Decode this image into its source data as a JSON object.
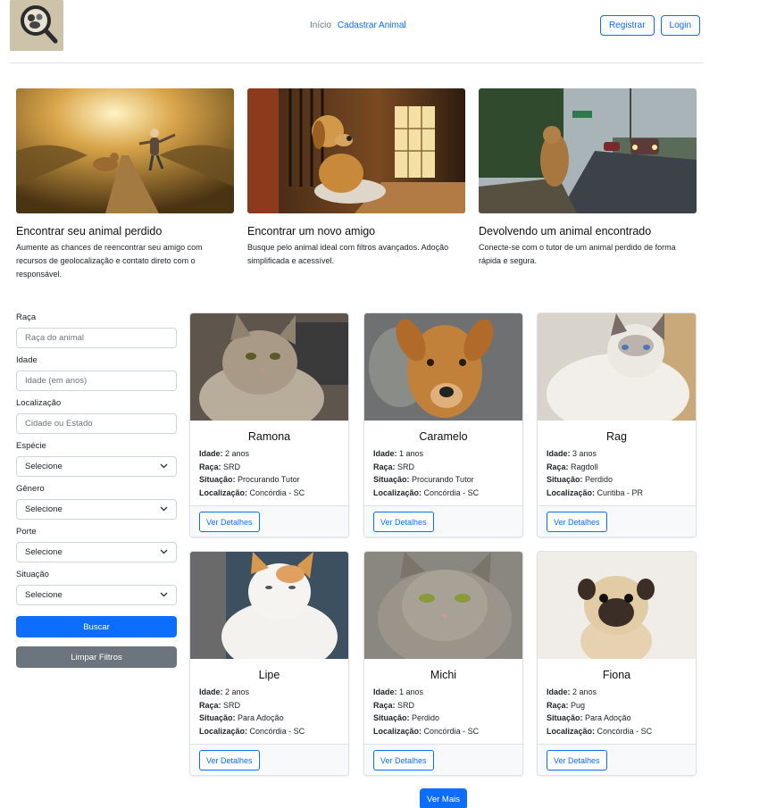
{
  "nav": {
    "home": "Início",
    "register_animal": "Cadastrar Animal"
  },
  "auth": {
    "register": "Registrar",
    "login": "Login"
  },
  "features": [
    {
      "title": "Encontrar seu animal perdido",
      "text": "Aumente as chances de reencontrar seu amigo com recursos de geolocalização e contato direto com o responsável."
    },
    {
      "title": "Encontrar um novo amigo",
      "text": "Busque pelo animal ideal com filtros avançados. Adoção simplificada e acessível."
    },
    {
      "title": "Devolvendo um animal encontrado",
      "text": "Conecte-se com o tutor de um animal perdido de forma rápida e segura."
    }
  ],
  "filters": {
    "breed": {
      "label": "Raça",
      "placeholder": "Raça do animal"
    },
    "age": {
      "label": "Idade",
      "placeholder": "Idade (em anos)"
    },
    "location": {
      "label": "Localização",
      "placeholder": "Cidade ou Estado"
    },
    "species": {
      "label": "Espécie",
      "value": "Selecione"
    },
    "gender": {
      "label": "Gênero",
      "value": "Selecione"
    },
    "size": {
      "label": "Porte",
      "value": "Selecione"
    },
    "status": {
      "label": "Situação",
      "value": "Selecione"
    },
    "search_button": "Buscar",
    "clear_button": "Limpar Filtros"
  },
  "labels": {
    "age": "Idade:",
    "breed": "Raça:",
    "status": "Situação:",
    "location": "Localização:",
    "details": "Ver Detalhes"
  },
  "animals": [
    {
      "name": "Ramona",
      "age": "2 anos",
      "breed": "SRD",
      "status": "Procurando Tutor",
      "location": "Concórdia - SC"
    },
    {
      "name": "Caramelo",
      "age": "1 anos",
      "breed": "SRD",
      "status": "Procurando Tutor",
      "location": "Concórdia - SC"
    },
    {
      "name": "Rag",
      "age": "3 anos",
      "breed": "Ragdoll",
      "status": "Perdido",
      "location": "Curitiba - PR"
    },
    {
      "name": "Lipe",
      "age": "2 anos",
      "breed": "SRD",
      "status": "Para Adoção",
      "location": "Concórdia - SC"
    },
    {
      "name": "Michi",
      "age": "1 anos",
      "breed": "SRD",
      "status": "Perdido",
      "location": "Concórdia - SC"
    },
    {
      "name": "Fiona",
      "age": "2 anos",
      "breed": "Pug",
      "status": "Para Adoção",
      "location": "Concórdia - SC"
    }
  ],
  "more_button": "Ver Mais",
  "colors": {
    "primary": "#0d6efd",
    "secondary": "#6c757d",
    "border": "#dee2e6"
  }
}
